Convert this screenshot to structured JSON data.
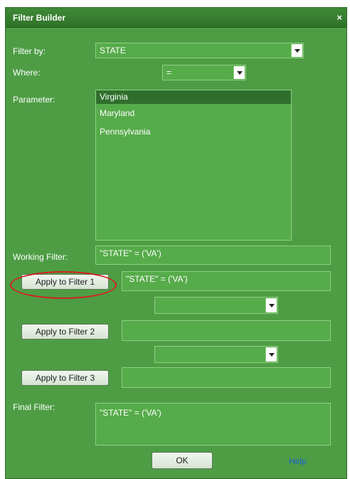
{
  "dialog": {
    "title": "Filter Builder",
    "close_glyph": "×"
  },
  "filter_by": {
    "label": "Filter by:",
    "value": "STATE"
  },
  "where": {
    "label": "Where:",
    "value": "="
  },
  "parameter": {
    "label": "Parameter:",
    "options": [
      "Virginia",
      "Maryland",
      "Pennsylvania"
    ],
    "selected": "Virginia"
  },
  "working_filter": {
    "label": "Working Filter:",
    "value": "\"STATE\" = ('VA')"
  },
  "filter1": {
    "button_label": "Apply to Filter 1",
    "value": "\"STATE\" = ('VA')"
  },
  "combine1": {
    "value": ""
  },
  "filter2": {
    "button_label": "Apply to Filter 2",
    "value": ""
  },
  "combine2": {
    "value": ""
  },
  "filter3": {
    "button_label": "Apply to Filter 3",
    "value": ""
  },
  "final_filter": {
    "label": "Final Filter:",
    "value": "\"STATE\" = ('VA')"
  },
  "footer": {
    "ok_label": "OK",
    "help_label": "Help"
  },
  "colors": {
    "panel": "#4e9d45",
    "field": "#56ab4a",
    "field_border": "#8fd082",
    "selected_row": "#2f6f2b",
    "annotation": "#d62020",
    "help_link": "#1a5fd6"
  },
  "icons": {
    "dropdown": "chevron-down-icon",
    "close": "close-icon"
  }
}
